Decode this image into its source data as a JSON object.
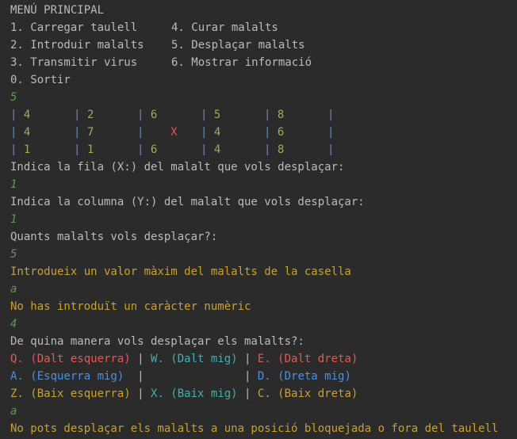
{
  "menu": {
    "title": "MENÚ PRINCIPAL",
    "rows": [
      {
        "left": "1. Carregar taulell",
        "right": "4. Curar malalts"
      },
      {
        "left": "2. Introduir malalts",
        "right": "5. Desplaçar malalts"
      },
      {
        "left": "3. Transmitir virus",
        "right": "6. Mostrar informació"
      }
    ],
    "exit": "0. Sortir"
  },
  "console": {
    "input_option": "5",
    "board": [
      [
        "4",
        "2",
        "6",
        "5",
        "8"
      ],
      [
        "4",
        "7",
        "X",
        "4",
        "6"
      ],
      [
        "1",
        "1",
        "6",
        "4",
        "8"
      ]
    ],
    "prompt_row": "Indica la fila (X:) del malalt que vols desplaçar:",
    "input_row": "1",
    "prompt_col": "Indica la columna (Y:) del malalt que vols desplaçar:",
    "input_col": "1",
    "prompt_count": "Quants malalts vols desplaçar?:",
    "input_count": "5",
    "warn_max": "Introdueix un valor màxim del malalts de la casella",
    "input_a1": "a",
    "warn_numeric": "No has introduït un caràcter numèric",
    "input_4": "4",
    "prompt_direction": "De quina manera vols desplaçar els malalts?:",
    "directions": {
      "q": "Q. (Dalt esquerra)",
      "w": "W. (Dalt mig)",
      "e": "E. (Dalt dreta)",
      "a": "A. (Esquerra mig)",
      "d": "D. (Dreta mig)",
      "z": "Z. (Baix esquerra)",
      "x": "X. (Baix mig)",
      "c": "C. (Baix dreta)"
    },
    "input_a2": "a",
    "warn_blocked": "No pots desplaçar els malalts a una posició bloquejada o fora del taulell"
  },
  "colors": {
    "background": "#2b2b2b",
    "text": "#bbbbbb",
    "input": "#629755",
    "warning": "#c9a032",
    "board_bar": "#4f8fdc",
    "board_number": "#8fb35a",
    "board_blocked": "#e05555"
  }
}
